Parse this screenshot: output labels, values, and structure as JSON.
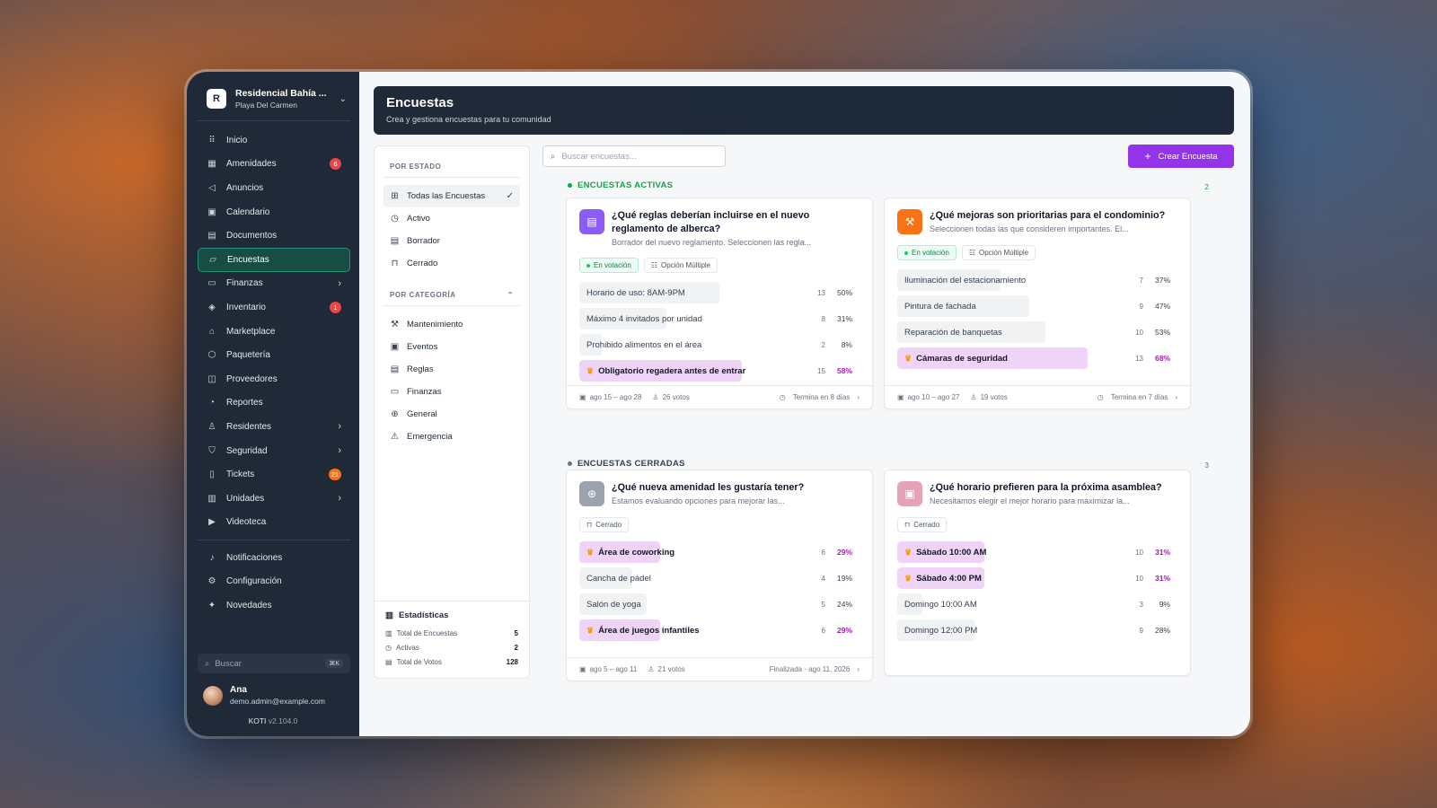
{
  "org": {
    "initial": "R",
    "name": "Residencial Bahía ...",
    "location": "Playa Del Carmen"
  },
  "nav": [
    {
      "label": "Inicio",
      "icon": "grid-icon",
      "glyph": "⠿"
    },
    {
      "label": "Amenidades",
      "icon": "building-icon",
      "glyph": "▦",
      "badge": "6"
    },
    {
      "label": "Anuncios",
      "icon": "megaphone-icon",
      "glyph": "◁"
    },
    {
      "label": "Calendario",
      "icon": "calendar-icon",
      "glyph": "▣"
    },
    {
      "label": "Documentos",
      "icon": "document-icon",
      "glyph": "▤"
    },
    {
      "label": "Encuestas",
      "icon": "poll-icon",
      "glyph": "▱",
      "active": true
    },
    {
      "label": "Finanzas",
      "icon": "wallet-icon",
      "glyph": "▭",
      "chevron": true
    },
    {
      "label": "Inventario",
      "icon": "box-icon",
      "glyph": "◈",
      "badge": "1"
    },
    {
      "label": "Marketplace",
      "icon": "store-icon",
      "glyph": "⌂"
    },
    {
      "label": "Paquetería",
      "icon": "package-icon",
      "glyph": "⬡"
    },
    {
      "label": "Proveedores",
      "icon": "truck-icon",
      "glyph": "◫"
    },
    {
      "label": "Reportes",
      "icon": "report-icon",
      "glyph": "◔"
    },
    {
      "label": "Residentes",
      "icon": "users-icon",
      "glyph": "♙",
      "chevron": true
    },
    {
      "label": "Seguridad",
      "icon": "shield-icon",
      "glyph": "⛉",
      "chevron": true
    },
    {
      "label": "Tickets",
      "icon": "ticket-icon",
      "glyph": "▯",
      "badge": "21",
      "badgeColor": "orange"
    },
    {
      "label": "Unidades",
      "icon": "unit-icon",
      "glyph": "▥",
      "chevron": true
    },
    {
      "label": "Videoteca",
      "icon": "video-icon",
      "glyph": "▶"
    }
  ],
  "nav_bottom": [
    {
      "label": "Notificaciones",
      "icon": "bell-icon",
      "glyph": "♪"
    },
    {
      "label": "Configuración",
      "icon": "gear-icon",
      "glyph": "⚙"
    },
    {
      "label": "Novedades",
      "icon": "sparkle-icon",
      "glyph": "✦"
    }
  ],
  "sidebar_search": {
    "placeholder": "Buscar",
    "shortcut": "⌘K"
  },
  "user": {
    "name": "Ana",
    "email": "demo.admin@example.com"
  },
  "app": {
    "name": "KOTI",
    "version": "v2.104.0"
  },
  "header": {
    "title": "Encuestas",
    "subtitle": "Crea y gestiona encuestas para tu comunidad"
  },
  "filters": {
    "by_status_label": "POR ESTADO",
    "status": [
      {
        "label": "Todas las Encuestas",
        "icon": "grid-icon",
        "glyph": "⊞",
        "active": true
      },
      {
        "label": "Activo",
        "icon": "clock-icon",
        "glyph": "◷"
      },
      {
        "label": "Borrador",
        "icon": "draft-icon",
        "glyph": "▤"
      },
      {
        "label": "Cerrado",
        "icon": "lock-icon",
        "glyph": "⊓"
      }
    ],
    "by_category_label": "POR CATEGORÍA",
    "categories": [
      {
        "label": "Mantenimiento",
        "icon": "wrench-icon",
        "glyph": "⚒"
      },
      {
        "label": "Eventos",
        "icon": "calendar-icon",
        "glyph": "▣"
      },
      {
        "label": "Reglas",
        "icon": "rules-icon",
        "glyph": "▤"
      },
      {
        "label": "Finanzas",
        "icon": "wallet-icon",
        "glyph": "▭"
      },
      {
        "label": "General",
        "icon": "globe-icon",
        "glyph": "⊕"
      },
      {
        "label": "Emergencia",
        "icon": "warning-icon",
        "glyph": "⚠"
      }
    ],
    "stats": {
      "title": "Estadísticas",
      "rows": [
        {
          "label": "Total de Encuestas",
          "value": "5",
          "glyph": "▥"
        },
        {
          "label": "Activas",
          "value": "2",
          "glyph": "◷"
        },
        {
          "label": "Total de Votos",
          "value": "128",
          "glyph": "▤"
        }
      ]
    }
  },
  "search": {
    "placeholder": "Buscar encuestas..."
  },
  "create_button": {
    "label": "Crear Encuesta"
  },
  "active_section": {
    "title": "ENCUESTAS ACTIVAS",
    "count": "2",
    "color": "#16a34a"
  },
  "closed_section": {
    "title": "ENCUESTAS CERRADAS",
    "count": "3",
    "color": "#6b7280"
  },
  "polls": [
    {
      "title": "¿Qué reglas deberían incluirse en el nuevo reglamento de alberca?",
      "description": "Borrador del nuevo reglamento. Seleccionen las regla...",
      "icon": "rules-icon",
      "glyph": "▤",
      "iconColor": "#8b5cf6",
      "status": "En votación",
      "type": "Opción Múltiple",
      "options": [
        {
          "label": "Horario de uso: 8AM-9PM",
          "votes": "13",
          "pct": 50
        },
        {
          "label": "Máximo 4 invitados por unidad",
          "votes": "8",
          "pct": 31
        },
        {
          "label": "Prohibido alimentos en el área",
          "votes": "2",
          "pct": 8
        },
        {
          "label": "Obligatorio regadera antes de entrar",
          "votes": "15",
          "pct": 58,
          "winner": true
        }
      ],
      "dates": "ago 15 – ago 28",
      "total_votes": "26 votos",
      "ends": "Termina en 8 días"
    },
    {
      "title": "¿Qué mejoras son prioritarias para el condominio?",
      "description": "Seleccionen todas las que consideren importantes. El...",
      "icon": "wrench-icon",
      "glyph": "⚒",
      "iconColor": "#f97316",
      "status": "En votación",
      "type": "Opción Múltiple",
      "options": [
        {
          "label": "Iluminación del estacionamiento",
          "votes": "7",
          "pct": 37
        },
        {
          "label": "Pintura de fachada",
          "votes": "9",
          "pct": 47
        },
        {
          "label": "Reparación de banquetas",
          "votes": "10",
          "pct": 53
        },
        {
          "label": "Cámaras de seguridad",
          "votes": "13",
          "pct": 68,
          "winner": true
        }
      ],
      "dates": "ago 10 – ago 27",
      "total_votes": "19 votos",
      "ends": "Termina en 7 días"
    },
    {
      "title": "¿Qué nueva amenidad les gustaría tener?",
      "description": "Estamos evaluando opciones para mejorar las...",
      "icon": "globe-icon",
      "glyph": "⊕",
      "iconColor": "#9ca3af",
      "status": "Cerrado",
      "options": [
        {
          "label": "Área de coworking",
          "votes": "6",
          "pct": 29,
          "winner": true
        },
        {
          "label": "Cancha de pádel",
          "votes": "4",
          "pct": 19
        },
        {
          "label": "Salón de yoga",
          "votes": "5",
          "pct": 24
        },
        {
          "label": "Área de juegos infantiles",
          "votes": "6",
          "pct": 29,
          "winner": true
        }
      ],
      "dates": "ago 5 – ago 11",
      "total_votes": "21 votos",
      "ends": "Finalizada · ago 11, 2026"
    },
    {
      "title": "¿Qué horario prefieren para la próxima asamblea?",
      "description": "Necesitamos elegir el mejor horario para maximizar la...",
      "icon": "calendar-icon",
      "glyph": "▣",
      "iconColor": "#e5a3b8",
      "status": "Cerrado",
      "options": [
        {
          "label": "Sábado 10:00 AM",
          "votes": "10",
          "pct": 31,
          "winner": true
        },
        {
          "label": "Sábado 4:00 PM",
          "votes": "10",
          "pct": 31,
          "winner": true
        },
        {
          "label": "Domingo 10:00 AM",
          "votes": "3",
          "pct": 9
        },
        {
          "label": "Domingo 12:00 PM",
          "votes": "9",
          "pct": 28
        }
      ]
    }
  ]
}
